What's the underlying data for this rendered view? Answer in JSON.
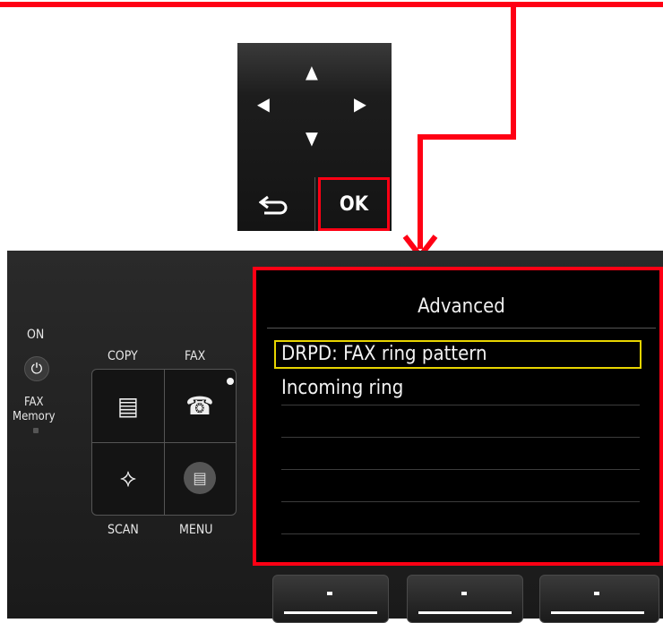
{
  "colors": {
    "highlight": "#ff0014",
    "selection": "#e8d500"
  },
  "dpad": {
    "up_icon": "triangle-up",
    "down_icon": "triangle-down",
    "left_icon": "triangle-left",
    "right_icon": "triangle-right",
    "back_icon": "back-arrow",
    "ok_label": "OK"
  },
  "panel": {
    "on_label": "ON",
    "fax_memory_label": "FAX\nMemory",
    "copy_label": "COPY",
    "fax_label": "FAX",
    "scan_label": "SCAN",
    "menu_label": "MENU"
  },
  "lcd": {
    "title": "Advanced",
    "items": [
      "DRPD: FAX ring pattern",
      "Incoming ring"
    ],
    "selected_index": 0
  },
  "function_buttons": [
    "left",
    "center",
    "right"
  ]
}
